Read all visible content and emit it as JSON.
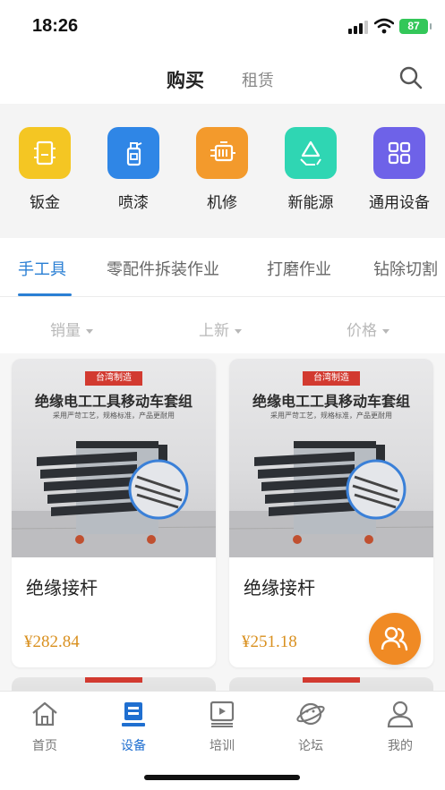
{
  "status_bar": {
    "time": "18:26",
    "battery": "87"
  },
  "header": {
    "tab_buy": "购买",
    "tab_rent": "租赁"
  },
  "categories": [
    {
      "label": "钣金",
      "icon": "sheet-metal-icon",
      "color": "#f4c623"
    },
    {
      "label": "喷漆",
      "icon": "spray-paint-icon",
      "color": "#2f86e6"
    },
    {
      "label": "机修",
      "icon": "engine-icon",
      "color": "#f39a2c"
    },
    {
      "label": "新能源",
      "icon": "recycle-icon",
      "color": "#2fd6b3"
    },
    {
      "label": "通用设备",
      "icon": "grid-icon",
      "color": "#6e62e8"
    }
  ],
  "subtabs": [
    "手工具",
    "零配件拆装作业",
    "打磨作业",
    "钻除切割"
  ],
  "active_subtab": "手工具",
  "sort": {
    "sales": "销量",
    "new": "上新",
    "price": "价格"
  },
  "products": [
    {
      "badge": "台湾制造",
      "image_title": "绝缘电工工具移动车套组",
      "image_subtitle": "采用严苛工艺，规格标准，产品更耐用",
      "name": "绝缘接杆",
      "price": "¥282.84"
    },
    {
      "badge": "台湾制造",
      "image_title": "绝缘电工工具移动车套组",
      "image_subtitle": "采用严苛工艺，规格标准，产品更耐用",
      "name": "绝缘接杆",
      "price": "¥251.18"
    }
  ],
  "bottom_nav": [
    {
      "label": "首页",
      "icon": "home-icon",
      "active": false
    },
    {
      "label": "设备",
      "icon": "equipment-icon",
      "active": true
    },
    {
      "label": "培训",
      "icon": "training-video-icon",
      "active": false
    },
    {
      "label": "论坛",
      "icon": "forum-planet-icon",
      "active": false
    },
    {
      "label": "我的",
      "icon": "profile-icon",
      "active": false
    }
  ],
  "colors": {
    "accent": "#2a7fd4",
    "price": "#d9901f",
    "service": "#f08a24",
    "battery": "#33c759"
  }
}
